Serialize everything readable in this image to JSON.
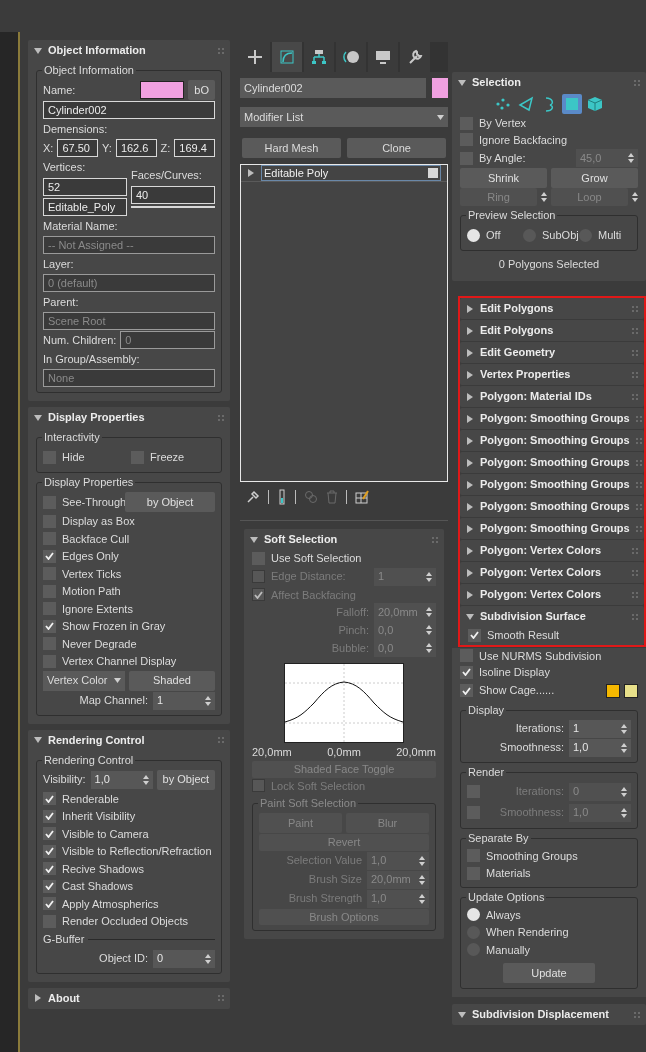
{
  "left_panel": {
    "rollouts": [
      {
        "title": "Object Information",
        "expanded": true,
        "items": [
          {
            "kind": "group",
            "title": "Object Information",
            "items": [
              {
                "kind": "row",
                "items": [
                  {
                    "kind": "text",
                    "text": "Name:"
                  },
                  {
                    "kind": "color_button",
                    "color": "#f0a0e0"
                  },
                  {
                    "kind": "button",
                    "label": "bO"
                  }
                ]
              },
              {
                "kind": "field",
                "value": "Cylinder002"
              },
              {
                "kind": "text",
                "text": "Demensions:"
              },
              {
                "kind": "row",
                "items": [
                  {
                    "kind": "text",
                    "text": "X:"
                  },
                  {
                    "kind": "field",
                    "value": "67.50"
                  },
                  {
                    "kind": "text",
                    "text": "Y:"
                  },
                  {
                    "kind": "field",
                    "value": "162.6"
                  },
                  {
                    "kind": "text",
                    "text": "Z:"
                  },
                  {
                    "kind": "field",
                    "value": "169.4"
                  }
                ]
              },
              {
                "kind": "row",
                "items": [
                  {
                    "kind": "col",
                    "items": [
                      {
                        "kind": "text",
                        "text": "Vertices:"
                      },
                      {
                        "kind": "field",
                        "value": "52"
                      },
                      {
                        "kind": "field",
                        "value": "Editable_Poly"
                      }
                    ]
                  },
                  {
                    "kind": "col",
                    "items": [
                      {
                        "kind": "text",
                        "text": "Faces/Curves:"
                      },
                      {
                        "kind": "field",
                        "value": "40"
                      },
                      {
                        "kind": "field"
                      }
                    ]
                  }
                ]
              },
              {
                "kind": "text",
                "text": "Material Name:"
              },
              {
                "kind": "field",
                "value": "-- Not Assigned --",
                "disabled": true
              },
              {
                "kind": "text",
                "text": "Layer:"
              },
              {
                "kind": "field",
                "value": "0 (default)",
                "disabled": true
              },
              {
                "kind": "text",
                "text": "Parent:"
              },
              {
                "kind": "field",
                "value": "Scene Root",
                "disabled": true
              },
              {
                "kind": "row",
                "items": [
                  {
                    "kind": "text",
                    "text": "Num. Children:"
                  },
                  {
                    "kind": "field",
                    "value": "0",
                    "disabled": true
                  }
                ]
              },
              {
                "kind": "text",
                "text": "In Group/Assembly:"
              },
              {
                "kind": "field",
                "value": "None",
                "disabled": true
              }
            ]
          }
        ]
      },
      {
        "title": "Display Properties",
        "expanded": true,
        "items": [
          {
            "kind": "group",
            "title": "Interactivity",
            "items": [
              {
                "kind": "row",
                "items": [
                  {
                    "kind": "check",
                    "label": "Hide",
                    "checked": false
                  },
                  {
                    "kind": "check",
                    "label": "Freeze",
                    "checked": false
                  }
                ]
              }
            ]
          },
          {
            "kind": "group",
            "title": "Display Properties",
            "items": [
              {
                "kind": "row",
                "items": [
                  {
                    "kind": "check",
                    "label": "See-Through",
                    "checked": false
                  },
                  {
                    "kind": "button",
                    "label": "by Object"
                  }
                ]
              },
              {
                "kind": "check",
                "label": "Display as Box",
                "checked": false
              },
              {
                "kind": "check",
                "label": "Backface Cull",
                "checked": false
              },
              {
                "kind": "check",
                "label": "Edges Only",
                "checked": true
              },
              {
                "kind": "check",
                "label": "Vertex Ticks",
                "checked": false
              },
              {
                "kind": "check",
                "label": "Motion Path",
                "checked": false
              },
              {
                "kind": "check",
                "label": "Ignore Extents",
                "checked": false
              },
              {
                "kind": "check",
                "label": "Show Frozen in Gray",
                "checked": true
              },
              {
                "kind": "check",
                "label": "Never Degrade",
                "checked": false
              },
              {
                "kind": "check",
                "label": "Vertex Channel Display",
                "checked": false
              },
              {
                "kind": "row",
                "items": [
                  {
                    "kind": "dropdown",
                    "value": "Vertex Color"
                  },
                  {
                    "kind": "button",
                    "label": "Shaded"
                  }
                ]
              },
              {
                "kind": "spinner",
                "label": "Map Channel:",
                "value": "1"
              }
            ]
          }
        ]
      },
      {
        "title": "Rendering Control",
        "expanded": true,
        "items": [
          {
            "kind": "group",
            "title": "Rendering Control",
            "items": [
              {
                "kind": "row",
                "items": [
                  {
                    "kind": "spinner",
                    "label": "Visibility:",
                    "value": "1,0"
                  },
                  {
                    "kind": "button",
                    "label": "by Object"
                  }
                ]
              },
              {
                "kind": "check",
                "label": "Renderable",
                "checked": true
              },
              {
                "kind": "check",
                "label": "Inherit Visibility",
                "checked": true
              },
              {
                "kind": "check",
                "label": "Visible to Camera",
                "checked": true
              },
              {
                "kind": "check",
                "label": "Visible to Reflection/Refraction",
                "checked": true
              },
              {
                "kind": "check",
                "label": "Recive Shadows",
                "checked": true
              },
              {
                "kind": "check",
                "label": "Cast Shadows",
                "checked": true
              },
              {
                "kind": "check",
                "label": "Apply Atmospherics",
                "checked": true
              },
              {
                "kind": "check",
                "label": "Render Occluded Objects",
                "checked": false
              },
              {
                "kind": "section",
                "text": "G-Buffer"
              },
              {
                "kind": "spinner",
                "label": "Object ID:",
                "value": "0"
              }
            ]
          }
        ]
      },
      {
        "title": "About",
        "expanded": false
      }
    ]
  },
  "modify_panel": {
    "command_tabs": [
      {
        "selected": false
      },
      {
        "selected": true
      },
      {
        "selected": false
      },
      {
        "selected": false
      },
      {
        "selected": false
      },
      {
        "selected": false
      }
    ],
    "object_name": "Cylinder002",
    "name_swatch": {
      "color": "#f0a0e0"
    },
    "modifier_list": "Modifier List",
    "buttons": [
      "Hard Mesh",
      "Clone"
    ],
    "stack": [
      {
        "label": "Editable Poly",
        "expanded": false
      }
    ],
    "rollouts": [
      {
        "title": "Soft Selection",
        "expanded": true,
        "items": [
          {
            "kind": "check",
            "label": "Use Soft Selection",
            "checked": false
          },
          {
            "kind": "row",
            "items": [
              {
                "kind": "check",
                "label": "Edge Distance:",
                "checked": false,
                "disabled": true
              },
              {
                "kind": "spinner",
                "value": "1",
                "disabled": true
              }
            ]
          },
          {
            "kind": "check",
            "label": "Affect Backfacing",
            "checked": true,
            "disabled": true
          },
          {
            "kind": "spinner",
            "label": "Falloff:",
            "value": "20,0mm",
            "disabled": true
          },
          {
            "kind": "spinner",
            "label": "Pinch:",
            "value": "0,0",
            "disabled": true
          },
          {
            "kind": "spinner",
            "label": "Bubble:",
            "value": "0,0",
            "disabled": true
          },
          {
            "kind": "curve"
          },
          {
            "kind": "spread",
            "items": [
              {
                "kind": "text",
                "text": "20,0mm"
              },
              {
                "kind": "text",
                "text": "0,0mm"
              },
              {
                "kind": "text",
                "text": "20,0mm"
              }
            ]
          },
          {
            "kind": "button",
            "label": "Shaded Face Toggle",
            "disabled": true
          },
          {
            "kind": "check",
            "label": "Lock Soft Selection",
            "checked": false,
            "disabled": true
          },
          {
            "kind": "group",
            "title": "Paint Soft Selection",
            "disabled": true,
            "items": [
              {
                "kind": "row",
                "items": [
                  {
                    "kind": "button",
                    "label": "Paint",
                    "disabled": true
                  },
                  {
                    "kind": "button",
                    "label": "Blur",
                    "disabled": true
                  }
                ]
              },
              {
                "kind": "button",
                "label": "Revert",
                "disabled": true
              },
              {
                "kind": "spinner",
                "label": "Selection Value",
                "value": "1,0",
                "disabled": true
              },
              {
                "kind": "spinner",
                "label": "Brush Size",
                "value": "20,0mm",
                "disabled": true
              },
              {
                "kind": "spinner",
                "label": "Brush Strength",
                "value": "1,0",
                "disabled": true
              },
              {
                "kind": "button",
                "label": "Brush Options",
                "disabled": true
              }
            ]
          }
        ]
      }
    ]
  },
  "right_panel": {
    "red_frame": true,
    "rollouts": [
      {
        "title": "Selection",
        "expanded": true,
        "items": [
          {
            "kind": "modes",
            "modes": [
              {
                "selected": false
              },
              {
                "selected": false
              },
              {
                "selected": false
              },
              {
                "selected": true
              },
              {
                "selected": false
              }
            ]
          },
          {
            "kind": "check",
            "label": "By Vertex",
            "checked": false
          },
          {
            "kind": "check",
            "label": "Ignore Backfacing",
            "checked": false
          },
          {
            "kind": "row",
            "items": [
              {
                "kind": "check",
                "label": "By Angle:",
                "checked": false
              },
              {
                "kind": "spinner",
                "value": "45,0",
                "disabled": true
              }
            ]
          },
          {
            "kind": "row",
            "items": [
              {
                "kind": "button",
                "label": "Shrink"
              },
              {
                "kind": "button",
                "label": "Grow"
              }
            ]
          },
          {
            "kind": "row",
            "items": [
              {
                "kind": "spinbutton",
                "label": "Ring",
                "disabled": true
              },
              {
                "kind": "spinbutton",
                "label": "Loop",
                "disabled": true
              }
            ]
          },
          {
            "kind": "group",
            "title": "Preview Selection",
            "items": [
              {
                "kind": "row",
                "items": [
                  {
                    "kind": "radio",
                    "label": "Off",
                    "selected": true
                  },
                  {
                    "kind": "radio",
                    "label": "SubObj",
                    "selected": false
                  },
                  {
                    "kind": "radio",
                    "label": "Multi",
                    "selected": false
                  }
                ]
              }
            ]
          },
          {
            "kind": "status",
            "text": "0 Polygons Selected"
          }
        ]
      },
      {
        "title": "Edit Polygons",
        "expanded": false
      },
      {
        "title": "Edit Polygons",
        "expanded": false
      },
      {
        "title": "Edit Geometry",
        "expanded": false
      },
      {
        "title": "Vertex Properties",
        "expanded": false
      },
      {
        "title": "Polygon: Material IDs",
        "expanded": false
      },
      {
        "title": "Polygon: Smoothing Groups",
        "expanded": false
      },
      {
        "title": "Polygon: Smoothing Groups",
        "expanded": false
      },
      {
        "title": "Polygon: Smoothing Groups",
        "expanded": false
      },
      {
        "title": "Polygon: Smoothing Groups",
        "expanded": false
      },
      {
        "title": "Polygon: Smoothing Groups",
        "expanded": false
      },
      {
        "title": "Polygon: Smoothing Groups",
        "expanded": false
      },
      {
        "title": "Polygon: Vertex Colors",
        "expanded": false
      },
      {
        "title": "Polygon: Vertex Colors",
        "expanded": false
      },
      {
        "title": "Polygon: Vertex Colors",
        "expanded": false
      },
      {
        "title": "Subdivision Surface",
        "expanded": true,
        "items": [
          {
            "kind": "check",
            "label": "Smooth Result",
            "checked": true
          },
          {
            "kind": "check",
            "label": "Use NURMS Subdivision",
            "checked": false
          },
          {
            "kind": "check",
            "label": "Isoline Display",
            "checked": true
          },
          {
            "kind": "row",
            "items": [
              {
                "kind": "check",
                "label": "Show Cage......",
                "checked": true
              },
              {
                "kind": "swatch",
                "color": "#f5b800"
              },
              {
                "kind": "swatch",
                "color": "#e8e08a"
              }
            ]
          },
          {
            "kind": "group",
            "title": "Display",
            "items": [
              {
                "kind": "spinner",
                "label": "Iterations:",
                "value": "1"
              },
              {
                "kind": "spinner",
                "label": "Smoothness:",
                "value": "1,0"
              }
            ]
          },
          {
            "kind": "group",
            "title": "Render",
            "items": [
              {
                "kind": "row",
                "items": [
                  {
                    "kind": "check",
                    "checked": false
                  },
                  {
                    "kind": "spinner",
                    "label": "Iterations:",
                    "value": "0",
                    "disabled": true
                  }
                ]
              },
              {
                "kind": "row",
                "items": [
                  {
                    "kind": "check",
                    "checked": false
                  },
                  {
                    "kind": "spinner",
                    "label": "Smoothness:",
                    "value": "1,0",
                    "disabled": true
                  }
                ]
              }
            ]
          },
          {
            "kind": "group",
            "title": "Separate By",
            "items": [
              {
                "kind": "check",
                "label": "Smoothing Groups",
                "checked": false
              },
              {
                "kind": "check",
                "label": "Materials",
                "checked": false
              }
            ]
          },
          {
            "kind": "group",
            "title": "Update Options",
            "items": [
              {
                "kind": "radio",
                "label": "Always",
                "selected": true
              },
              {
                "kind": "radio",
                "label": "When Rendering",
                "selected": false
              },
              {
                "kind": "radio",
                "label": "Manually",
                "selected": false
              },
              {
                "kind": "small_button",
                "label": "Update"
              }
            ]
          }
        ]
      },
      {
        "title": "Subdivision Displacement",
        "expanded": true
      }
    ]
  }
}
